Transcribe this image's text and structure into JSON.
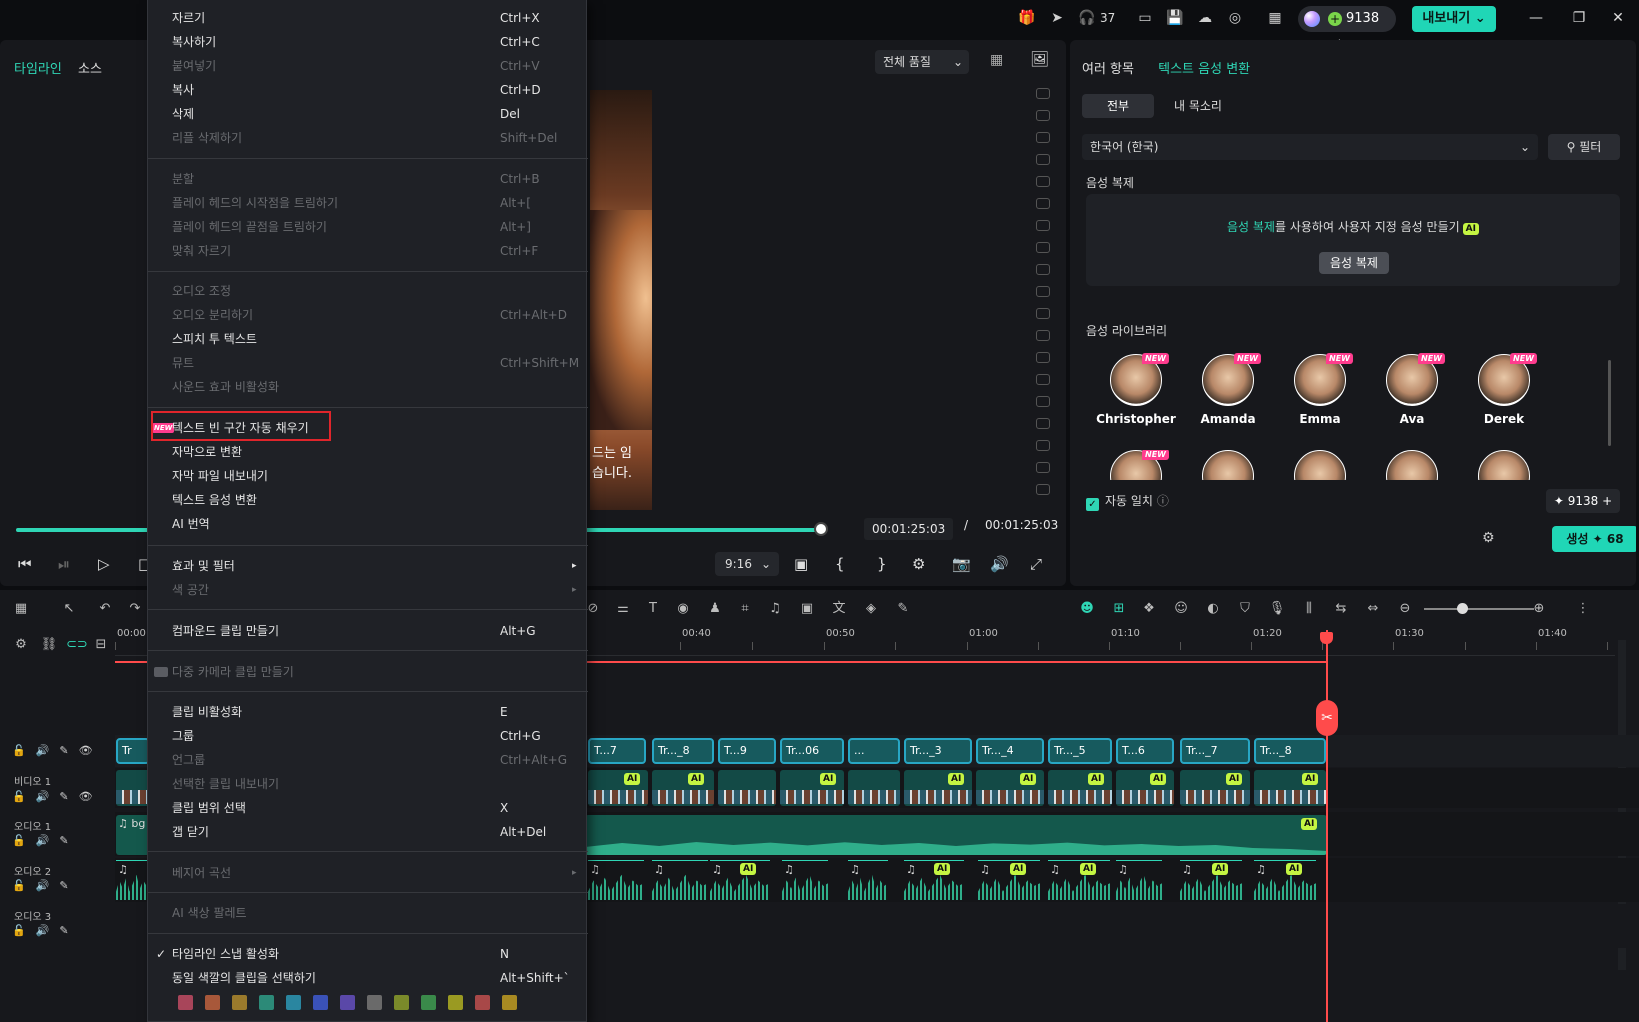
{
  "titlebar": {
    "notification_count": "37",
    "credits": "9138",
    "export_label": "내보내기"
  },
  "player": {
    "tab_timeline": "타임라인",
    "tab_source": "소스",
    "quality": "전체 품질",
    "subtitle_line1": "드는 임",
    "subtitle_line2": "습니다.",
    "time_current": "00:01:25:03",
    "time_separator": "/",
    "time_total": "00:01:25:03",
    "ratio": "9:16"
  },
  "right_panel": {
    "tab_multi": "여러 항목",
    "tab_tts": "텍스트 음성 변환",
    "seg_all": "전부",
    "seg_my_voice": "내 목소리",
    "language": "한국어 (한국)",
    "filter_label": "필터",
    "voice_clone_title": "음성 복제",
    "voice_clone_desc_hl": "음성 복제",
    "voice_clone_desc_rest": "를 사용하여 사용자 지정 음성 만들기",
    "ai_badge": "AI",
    "voice_clone_button": "음성 복제",
    "library_title": "음성 라이브러리",
    "new_badge": "NEW",
    "voices": [
      {
        "name": "Christopher",
        "new": true
      },
      {
        "name": "Amanda",
        "new": true
      },
      {
        "name": "Emma",
        "new": true
      },
      {
        "name": "Ava",
        "new": true
      },
      {
        "name": "Derek",
        "new": true
      }
    ],
    "auto_match": "자동 일치",
    "credits": "9138",
    "generate_label": "생성",
    "generate_cost": "68"
  },
  "timeline": {
    "ruler_labels": [
      "00:00",
      "00:40",
      "00:50",
      "01:00",
      "01:10",
      "01:20",
      "01:30",
      "01:40"
    ],
    "tracks": {
      "video1": "비디오 1",
      "audio1": "오디오 1",
      "audio2": "오디오 2",
      "audio3": "오디오 3"
    },
    "subtitle_clips": [
      "Tr",
      "T...7",
      "Tr..._8",
      "T...9",
      "Tr...06",
      "...",
      "Tr..._3",
      "Tr..._4",
      "Tr..._5",
      "T...6",
      "Tr..._7",
      "Tr..._8"
    ],
    "audio1_clip_label": "bg",
    "ai_badge": "AI"
  },
  "context_menu": {
    "items": [
      {
        "label": "자르기",
        "shortcut": "Ctrl+X",
        "enabled": true
      },
      {
        "label": "복사하기",
        "shortcut": "Ctrl+C",
        "enabled": true
      },
      {
        "label": "붙여넣기",
        "shortcut": "Ctrl+V",
        "enabled": false
      },
      {
        "label": "복사",
        "shortcut": "Ctrl+D",
        "enabled": true
      },
      {
        "label": "삭제",
        "shortcut": "Del",
        "enabled": true
      },
      {
        "label": "리플 삭제하기",
        "shortcut": "Shift+Del",
        "enabled": false
      },
      {
        "label": "분할",
        "shortcut": "Ctrl+B",
        "enabled": false
      },
      {
        "label": "플레이 헤드의 시작점을 트림하기",
        "shortcut": "Alt+[",
        "enabled": false
      },
      {
        "label": "플레이 헤드의 끝점을 트림하기",
        "shortcut": "Alt+]",
        "enabled": false
      },
      {
        "label": "맞춰 자르기",
        "shortcut": "Ctrl+F",
        "enabled": false
      },
      {
        "label": "오디오 조정",
        "shortcut": "",
        "enabled": false
      },
      {
        "label": "오디오 분리하기",
        "shortcut": "Ctrl+Alt+D",
        "enabled": false
      },
      {
        "label": "스피치 투 텍스트",
        "shortcut": "",
        "enabled": true
      },
      {
        "label": "뮤트",
        "shortcut": "Ctrl+Shift+M",
        "enabled": false
      },
      {
        "label": "사운드 효과 비활성화",
        "shortcut": "",
        "enabled": false
      },
      {
        "label": "텍스트 빈 구간 자동 채우기",
        "shortcut": "",
        "enabled": true,
        "new": true
      },
      {
        "label": "자막으로 변환",
        "shortcut": "",
        "enabled": true
      },
      {
        "label": "자막 파일 내보내기",
        "shortcut": "",
        "enabled": true
      },
      {
        "label": "텍스트 음성 변환",
        "shortcut": "",
        "enabled": true
      },
      {
        "label": "AI 번역",
        "shortcut": "",
        "enabled": true
      },
      {
        "label": "효과 및 필터",
        "shortcut": "",
        "enabled": true,
        "submenu": true
      },
      {
        "label": "색 공간",
        "shortcut": "",
        "enabled": false,
        "submenu": true
      },
      {
        "label": "컴파운드 클립 만들기",
        "shortcut": "Alt+G",
        "enabled": true
      },
      {
        "label": "다중 카메라 클립 만들기",
        "shortcut": "",
        "enabled": false
      },
      {
        "label": "클립 비활성화",
        "shortcut": "E",
        "enabled": true
      },
      {
        "label": "그룹",
        "shortcut": "Ctrl+G",
        "enabled": true
      },
      {
        "label": "언그룹",
        "shortcut": "Ctrl+Alt+G",
        "enabled": false
      },
      {
        "label": "선택한 클립 내보내기",
        "shortcut": "",
        "enabled": false
      },
      {
        "label": "클립 범위 선택",
        "shortcut": "X",
        "enabled": true
      },
      {
        "label": "갭 닫기",
        "shortcut": "Alt+Del",
        "enabled": true
      },
      {
        "label": "베지어 곡선",
        "shortcut": "",
        "enabled": false,
        "submenu": true
      },
      {
        "label": "AI 색상 팔레트",
        "shortcut": "",
        "enabled": false
      },
      {
        "label": "타임라인 스냅 활성화",
        "shortcut": "N",
        "enabled": true,
        "checked": true
      },
      {
        "label": "동일 색깔의 클립을 선택하기",
        "shortcut": "Alt+Shift+`",
        "enabled": true
      }
    ],
    "new_tag": "NEW",
    "swatch_colors": [
      "#a8455a",
      "#a8583a",
      "#9a7a2c",
      "#2c8a78",
      "#2a86a0",
      "#3a52b8",
      "#5a48a8",
      "#6a6a6a",
      "#7a8a2a",
      "#3a8a4a",
      "#9a9a22",
      "#a84848",
      "#a88a22"
    ]
  }
}
